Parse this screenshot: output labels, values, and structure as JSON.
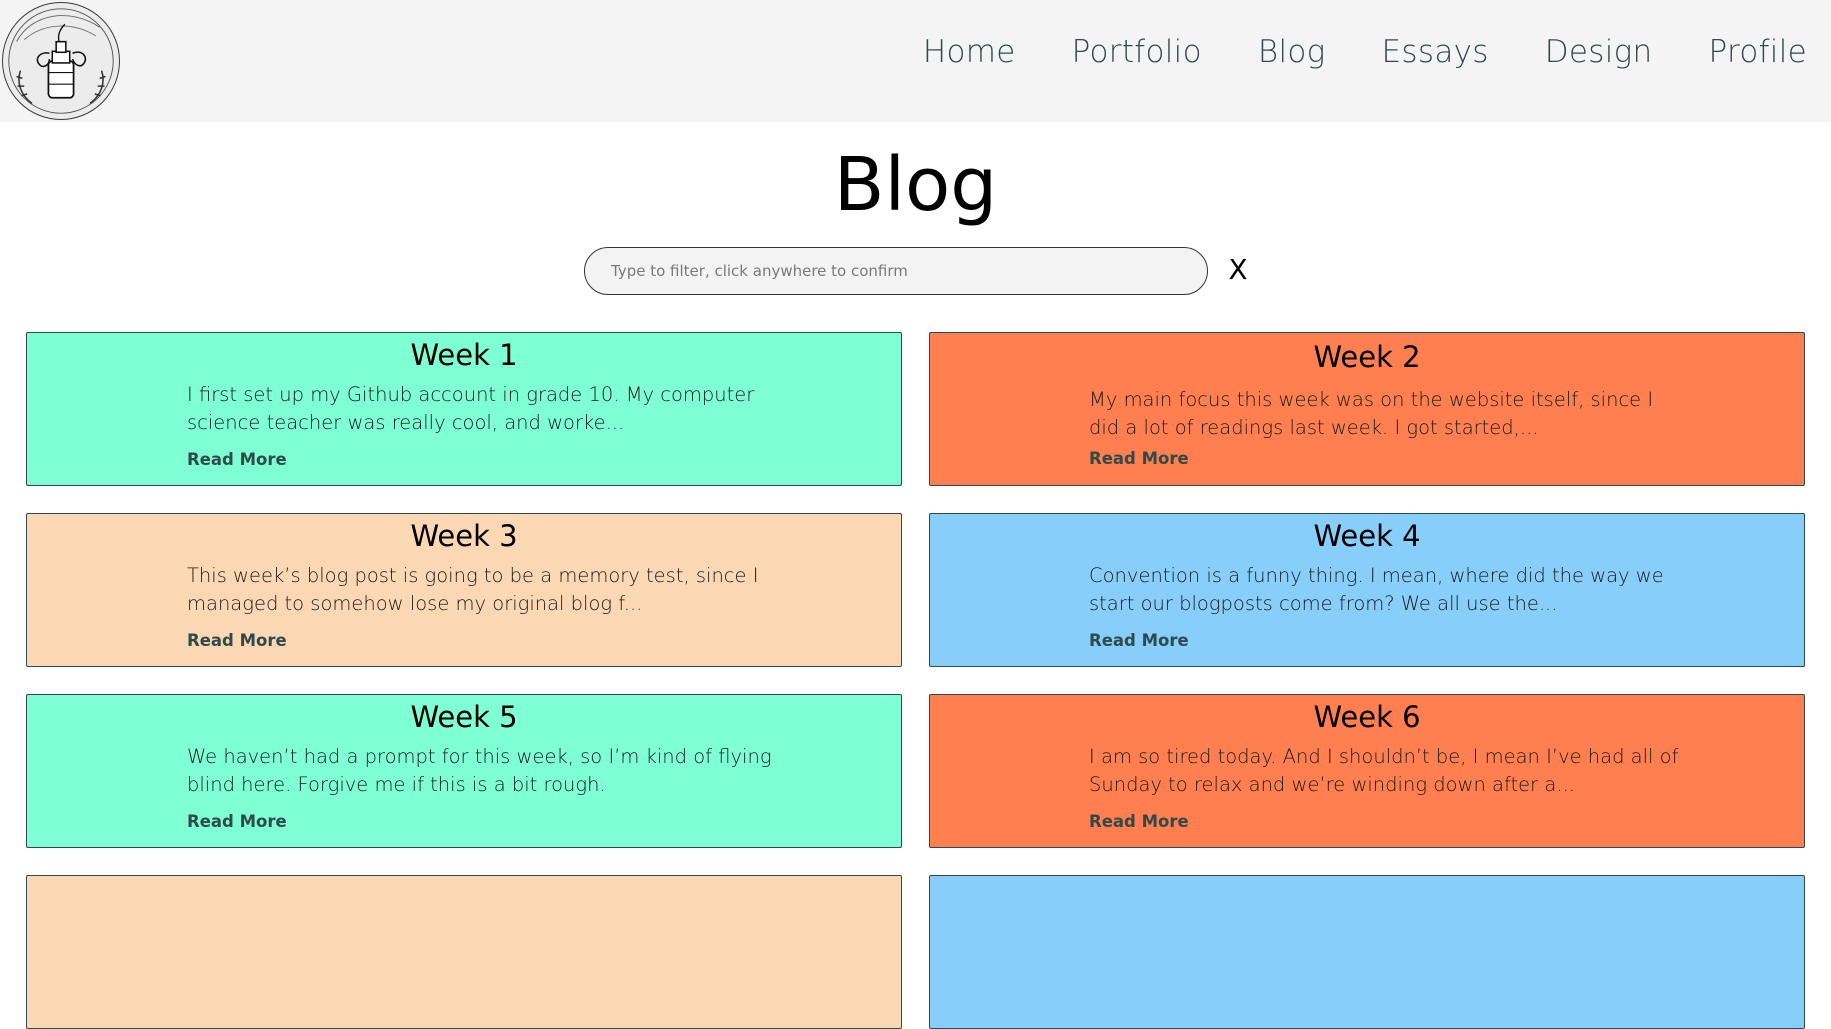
{
  "header": {
    "nav": [
      "Home",
      "Portfolio",
      "Blog",
      "Essays",
      "Design",
      "Profile"
    ]
  },
  "page": {
    "title": "Blog"
  },
  "filter": {
    "placeholder": "Type to filter, click anywhere to confirm",
    "value": "",
    "clear_label": "X"
  },
  "posts": [
    {
      "title": "Week 1",
      "excerpt": "I first set up my Github account in grade 10. My computer science teacher was really cool, and worke...",
      "link": "Read More",
      "color": "#7fffd4"
    },
    {
      "title": "Week 2",
      "excerpt": "My main focus this week was on the website itself, since I did a lot of readings last week. I got started,...",
      "link": "Read More",
      "color": "#ff7f50"
    },
    {
      "title": "Week 3",
      "excerpt": "This week’s blog post is going to be a memory test, since I managed to somehow lose my original blog f...",
      "link": "Read More",
      "color": "#fcd7b4"
    },
    {
      "title": "Week 4",
      "excerpt": "Convention is a funny thing. I mean, where did the way we start our blogposts come from? We all use the...",
      "link": "Read More",
      "color": "#87cefa"
    },
    {
      "title": "Week 5",
      "excerpt": "We haven’t had a prompt for this week, so I’m kind of flying blind here. Forgive me if this is a bit rough.",
      "link": "Read More",
      "color": "#7fffd4"
    },
    {
      "title": "Week 6",
      "excerpt": "I am so tired today. And I shouldn’t be, I mean I’ve had all of Sunday to relax and we’re winding down after a...",
      "link": "Read More",
      "color": "#ff7f50"
    }
  ],
  "peek_cards": [
    {
      "color": "#fcd7b4"
    },
    {
      "color": "#87cefa"
    }
  ]
}
